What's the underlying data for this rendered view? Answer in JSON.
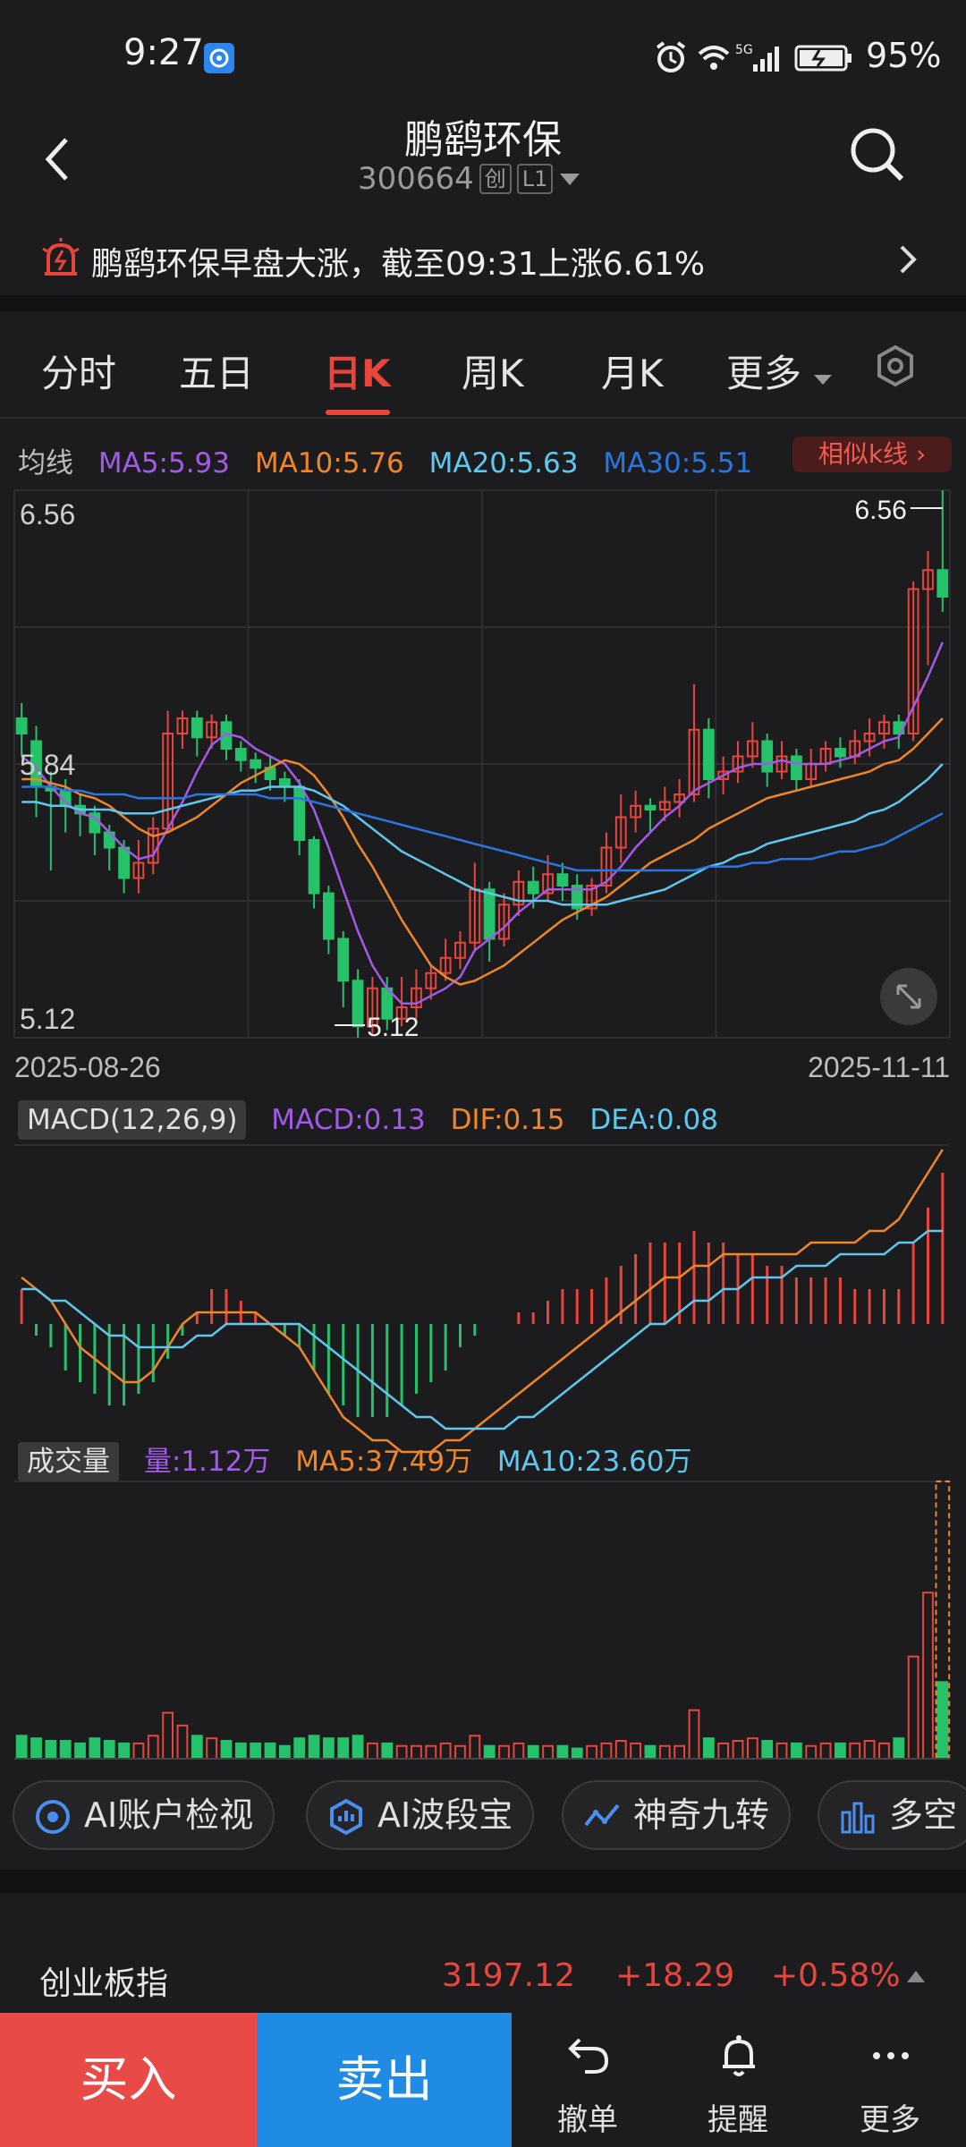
{
  "status_bar": {
    "time": "9:27",
    "battery": "95%",
    "network": "5G",
    "icons": [
      "app-badge-icon",
      "alarm-icon",
      "wifi-icon",
      "signal-icon",
      "battery-icon"
    ]
  },
  "header": {
    "title": "鹏鹞环保",
    "code": "300664",
    "tag_board": "创",
    "tag_level": "L1",
    "notice": "鹏鹞环保早盘大涨，截至09:31上涨6.61%"
  },
  "tabs": [
    {
      "label": "分时"
    },
    {
      "label": "五日"
    },
    {
      "label": "日K"
    },
    {
      "label": "周K"
    },
    {
      "label": "月K"
    },
    {
      "label": "更多"
    }
  ],
  "active_tab": "日K",
  "ma_legend": {
    "label": "均线",
    "ma5": "MA5:5.93",
    "ma10": "MA10:5.76",
    "ma20": "MA20:5.63",
    "ma30": "MA30:5.51",
    "similar": "相似k线"
  },
  "colors": {
    "up": "#e8453c",
    "down": "#25c26a",
    "ma5": "#a35ae8",
    "ma10": "#f0862a",
    "ma20": "#5ec8ee",
    "ma30": "#2a76e0",
    "background": "#1c1c1e"
  },
  "kline": {
    "y_labels": [
      "6.56",
      "5.84",
      "5.12"
    ],
    "high_mark": "6.56",
    "low_mark": "5.12",
    "start_date": "2025-08-26",
    "end_date": "2025-11-11"
  },
  "macd": {
    "selector": "MACD(12,26,9)",
    "macd": "MACD:0.13",
    "dif": "DIF:0.15",
    "dea": "DEA:0.08"
  },
  "volume": {
    "selector": "成交量",
    "vol": "量:1.12万",
    "ma5": "MA5:37.49万",
    "ma10": "MA10:23.60万"
  },
  "chart_data": {
    "type": "candlestick",
    "title": "",
    "x_range": [
      "2025-08-26",
      "2025-11-11"
    ],
    "ylim": [
      5.12,
      6.56
    ],
    "grid": true,
    "candles": [
      [
        5.96,
        5.92,
        6.0,
        5.86
      ],
      [
        5.9,
        5.78,
        5.94,
        5.7
      ],
      [
        5.78,
        5.77,
        5.82,
        5.56
      ],
      [
        5.77,
        5.73,
        5.8,
        5.66
      ],
      [
        5.73,
        5.71,
        5.76,
        5.65
      ],
      [
        5.71,
        5.66,
        5.73,
        5.6
      ],
      [
        5.66,
        5.62,
        5.68,
        5.56
      ],
      [
        5.62,
        5.54,
        5.64,
        5.5
      ],
      [
        5.54,
        5.58,
        5.64,
        5.5
      ],
      [
        5.58,
        5.67,
        5.7,
        5.55
      ],
      [
        5.67,
        5.92,
        5.98,
        5.66
      ],
      [
        5.92,
        5.96,
        5.98,
        5.88
      ],
      [
        5.96,
        5.91,
        5.98,
        5.86
      ],
      [
        5.91,
        5.95,
        5.97,
        5.88
      ],
      [
        5.95,
        5.88,
        5.97,
        5.85
      ],
      [
        5.88,
        5.85,
        5.9,
        5.82
      ],
      [
        5.85,
        5.83,
        5.87,
        5.79
      ],
      [
        5.83,
        5.8,
        5.86,
        5.77
      ],
      [
        5.8,
        5.78,
        5.82,
        5.74
      ],
      [
        5.78,
        5.64,
        5.8,
        5.6
      ],
      [
        5.64,
        5.5,
        5.65,
        5.46
      ],
      [
        5.5,
        5.38,
        5.52,
        5.34
      ],
      [
        5.38,
        5.27,
        5.4,
        5.2
      ],
      [
        5.27,
        5.15,
        5.3,
        5.12
      ],
      [
        5.15,
        5.25,
        5.28,
        5.13
      ],
      [
        5.25,
        5.17,
        5.28,
        5.14
      ],
      [
        5.17,
        5.2,
        5.28,
        5.15
      ],
      [
        5.2,
        5.25,
        5.3,
        5.17
      ],
      [
        5.25,
        5.29,
        5.31,
        5.22
      ],
      [
        5.29,
        5.33,
        5.38,
        5.27
      ],
      [
        5.33,
        5.37,
        5.4,
        5.3
      ],
      [
        5.37,
        5.51,
        5.58,
        5.35
      ],
      [
        5.51,
        5.38,
        5.53,
        5.32
      ],
      [
        5.38,
        5.47,
        5.5,
        5.36
      ],
      [
        5.47,
        5.53,
        5.56,
        5.44
      ],
      [
        5.53,
        5.5,
        5.57,
        5.46
      ],
      [
        5.5,
        5.55,
        5.6,
        5.48
      ],
      [
        5.55,
        5.52,
        5.58,
        5.48
      ],
      [
        5.52,
        5.46,
        5.55,
        5.43
      ],
      [
        5.46,
        5.52,
        5.54,
        5.44
      ],
      [
        5.52,
        5.62,
        5.66,
        5.5
      ],
      [
        5.62,
        5.7,
        5.76,
        5.58
      ],
      [
        5.7,
        5.73,
        5.77,
        5.66
      ],
      [
        5.73,
        5.72,
        5.75,
        5.66
      ],
      [
        5.72,
        5.74,
        5.78,
        5.69
      ],
      [
        5.74,
        5.76,
        5.8,
        5.7
      ],
      [
        5.76,
        5.93,
        6.05,
        5.74
      ],
      [
        5.93,
        5.8,
        5.96,
        5.75
      ],
      [
        5.8,
        5.82,
        5.86,
        5.76
      ],
      [
        5.82,
        5.86,
        5.9,
        5.79
      ],
      [
        5.86,
        5.9,
        5.95,
        5.83
      ],
      [
        5.9,
        5.82,
        5.92,
        5.78
      ],
      [
        5.82,
        5.86,
        5.9,
        5.8
      ],
      [
        5.86,
        5.8,
        5.88,
        5.77
      ],
      [
        5.8,
        5.84,
        5.88,
        5.78
      ],
      [
        5.84,
        5.88,
        5.9,
        5.82
      ],
      [
        5.88,
        5.86,
        5.91,
        5.83
      ],
      [
        5.86,
        5.9,
        5.93,
        5.84
      ],
      [
        5.9,
        5.92,
        5.96,
        5.86
      ],
      [
        5.92,
        5.95,
        5.97,
        5.88
      ],
      [
        5.95,
        5.92,
        5.97,
        5.88
      ],
      [
        5.92,
        6.3,
        6.32,
        5.9
      ],
      [
        6.3,
        6.35,
        6.4,
        6.1
      ],
      [
        6.35,
        6.28,
        6.56,
        6.24
      ]
    ],
    "series": [
      {
        "name": "MA5",
        "values": [
          5.86,
          5.83,
          5.78,
          5.74,
          5.71,
          5.7,
          5.66,
          5.62,
          5.59,
          5.6,
          5.67,
          5.74,
          5.82,
          5.89,
          5.92,
          5.91,
          5.88,
          5.86,
          5.84,
          5.79,
          5.72,
          5.62,
          5.51,
          5.4,
          5.31,
          5.25,
          5.21,
          5.21,
          5.23,
          5.25,
          5.28,
          5.35,
          5.38,
          5.41,
          5.45,
          5.48,
          5.51,
          5.51,
          5.51,
          5.51,
          5.53,
          5.57,
          5.62,
          5.66,
          5.7,
          5.73,
          5.77,
          5.79,
          5.81,
          5.83,
          5.84,
          5.84,
          5.85,
          5.84,
          5.84,
          5.84,
          5.85,
          5.86,
          5.88,
          5.9,
          5.91,
          5.99,
          6.07,
          6.16
        ]
      },
      {
        "name": "MA10",
        "values": [
          5.8,
          5.8,
          5.79,
          5.78,
          5.76,
          5.75,
          5.73,
          5.7,
          5.67,
          5.65,
          5.66,
          5.68,
          5.7,
          5.73,
          5.76,
          5.79,
          5.81,
          5.83,
          5.85,
          5.84,
          5.81,
          5.76,
          5.7,
          5.63,
          5.57,
          5.5,
          5.43,
          5.37,
          5.31,
          5.28,
          5.26,
          5.27,
          5.29,
          5.31,
          5.34,
          5.37,
          5.4,
          5.43,
          5.45,
          5.47,
          5.49,
          5.52,
          5.55,
          5.58,
          5.6,
          5.62,
          5.64,
          5.67,
          5.69,
          5.71,
          5.73,
          5.75,
          5.76,
          5.77,
          5.78,
          5.79,
          5.8,
          5.81,
          5.82,
          5.84,
          5.85,
          5.88,
          5.92,
          5.96
        ]
      },
      {
        "name": "MA20",
        "values": [
          5.74,
          5.74,
          5.73,
          5.73,
          5.72,
          5.72,
          5.72,
          5.71,
          5.71,
          5.71,
          5.72,
          5.73,
          5.74,
          5.75,
          5.76,
          5.77,
          5.77,
          5.78,
          5.78,
          5.78,
          5.77,
          5.75,
          5.73,
          5.7,
          5.67,
          5.64,
          5.61,
          5.59,
          5.57,
          5.55,
          5.53,
          5.51,
          5.5,
          5.49,
          5.48,
          5.48,
          5.48,
          5.47,
          5.47,
          5.47,
          5.47,
          5.48,
          5.49,
          5.5,
          5.51,
          5.53,
          5.55,
          5.57,
          5.58,
          5.6,
          5.61,
          5.63,
          5.64,
          5.65,
          5.66,
          5.67,
          5.68,
          5.69,
          5.71,
          5.72,
          5.74,
          5.77,
          5.8,
          5.84
        ]
      },
      {
        "name": "MA30",
        "values": [
          5.78,
          5.78,
          5.78,
          5.77,
          5.77,
          5.76,
          5.76,
          5.76,
          5.75,
          5.75,
          5.75,
          5.75,
          5.76,
          5.76,
          5.76,
          5.76,
          5.76,
          5.75,
          5.75,
          5.75,
          5.74,
          5.73,
          5.72,
          5.71,
          5.7,
          5.69,
          5.68,
          5.67,
          5.66,
          5.65,
          5.64,
          5.63,
          5.62,
          5.61,
          5.6,
          5.59,
          5.58,
          5.57,
          5.56,
          5.56,
          5.56,
          5.56,
          5.56,
          5.56,
          5.56,
          5.56,
          5.56,
          5.57,
          5.57,
          5.57,
          5.58,
          5.58,
          5.59,
          5.59,
          5.59,
          5.6,
          5.61,
          5.61,
          5.62,
          5.63,
          5.65,
          5.67,
          5.69,
          5.71
        ]
      }
    ],
    "macd": {
      "hist": [
        0.03,
        -0.01,
        -0.02,
        -0.04,
        -0.05,
        -0.06,
        -0.07,
        -0.07,
        -0.06,
        -0.05,
        -0.03,
        -0.01,
        0.01,
        0.03,
        0.03,
        0.02,
        0.01,
        0.0,
        -0.01,
        -0.02,
        -0.04,
        -0.06,
        -0.07,
        -0.08,
        -0.08,
        -0.08,
        -0.07,
        -0.06,
        -0.05,
        -0.04,
        -0.02,
        -0.01,
        0.0,
        0.0,
        0.01,
        0.01,
        0.02,
        0.03,
        0.03,
        0.03,
        0.04,
        0.05,
        0.06,
        0.07,
        0.07,
        0.07,
        0.08,
        0.07,
        0.07,
        0.06,
        0.06,
        0.05,
        0.05,
        0.04,
        0.04,
        0.04,
        0.04,
        0.03,
        0.03,
        0.03,
        0.03,
        0.07,
        0.1,
        0.13
      ],
      "dif": [
        0.04,
        0.03,
        0.02,
        0.0,
        -0.02,
        -0.03,
        -0.04,
        -0.05,
        -0.05,
        -0.04,
        -0.02,
        0.0,
        0.01,
        0.01,
        0.01,
        0.01,
        0.01,
        0.0,
        -0.01,
        -0.02,
        -0.04,
        -0.06,
        -0.08,
        -0.09,
        -0.1,
        -0.1,
        -0.11,
        -0.11,
        -0.11,
        -0.1,
        -0.1,
        -0.09,
        -0.08,
        -0.07,
        -0.06,
        -0.05,
        -0.04,
        -0.03,
        -0.02,
        -0.01,
        0.0,
        0.01,
        0.02,
        0.03,
        0.04,
        0.04,
        0.05,
        0.05,
        0.06,
        0.06,
        0.06,
        0.06,
        0.06,
        0.06,
        0.07,
        0.07,
        0.07,
        0.07,
        0.08,
        0.08,
        0.09,
        0.11,
        0.13,
        0.15
      ],
      "dea": [
        0.03,
        0.03,
        0.02,
        0.02,
        0.01,
        0.0,
        -0.01,
        -0.01,
        -0.02,
        -0.02,
        -0.02,
        -0.02,
        -0.01,
        -0.01,
        0.0,
        0.0,
        0.0,
        0.0,
        0.0,
        0.0,
        -0.01,
        -0.02,
        -0.03,
        -0.04,
        -0.05,
        -0.06,
        -0.07,
        -0.08,
        -0.08,
        -0.09,
        -0.09,
        -0.09,
        -0.09,
        -0.09,
        -0.08,
        -0.08,
        -0.07,
        -0.06,
        -0.05,
        -0.04,
        -0.03,
        -0.02,
        -0.01,
        0.0,
        0.0,
        0.01,
        0.02,
        0.02,
        0.03,
        0.03,
        0.04,
        0.04,
        0.04,
        0.05,
        0.05,
        0.05,
        0.06,
        0.06,
        0.06,
        0.06,
        0.07,
        0.07,
        0.08,
        0.08
      ]
    },
    "volume": [
      0.9,
      0.8,
      0.7,
      0.7,
      0.6,
      0.8,
      0.7,
      0.6,
      0.6,
      0.9,
      1.8,
      1.3,
      0.9,
      0.8,
      0.7,
      0.6,
      0.6,
      0.6,
      0.5,
      0.8,
      0.9,
      0.8,
      0.8,
      0.9,
      0.6,
      0.6,
      0.5,
      0.5,
      0.5,
      0.6,
      0.5,
      0.9,
      0.5,
      0.5,
      0.6,
      0.5,
      0.5,
      0.5,
      0.4,
      0.5,
      0.6,
      0.7,
      0.6,
      0.5,
      0.5,
      0.5,
      1.9,
      0.8,
      0.6,
      0.7,
      0.8,
      0.7,
      0.6,
      0.6,
      0.5,
      0.6,
      0.6,
      0.6,
      0.7,
      0.6,
      0.8,
      4.0,
      6.5,
      3.0
    ]
  },
  "ai_tools": [
    {
      "label": "AI账户检视"
    },
    {
      "label": "AI波段宝"
    },
    {
      "label": "神奇九转"
    },
    {
      "label": "多空"
    }
  ],
  "index_row": {
    "name": "创业板指",
    "value": "3197.12",
    "change": "+18.29",
    "pct": "+0.58%"
  },
  "bottom_bar": {
    "buy": "买入",
    "sell": "卖出",
    "cancel": "撤单",
    "remind": "提醒",
    "more": "更多"
  }
}
